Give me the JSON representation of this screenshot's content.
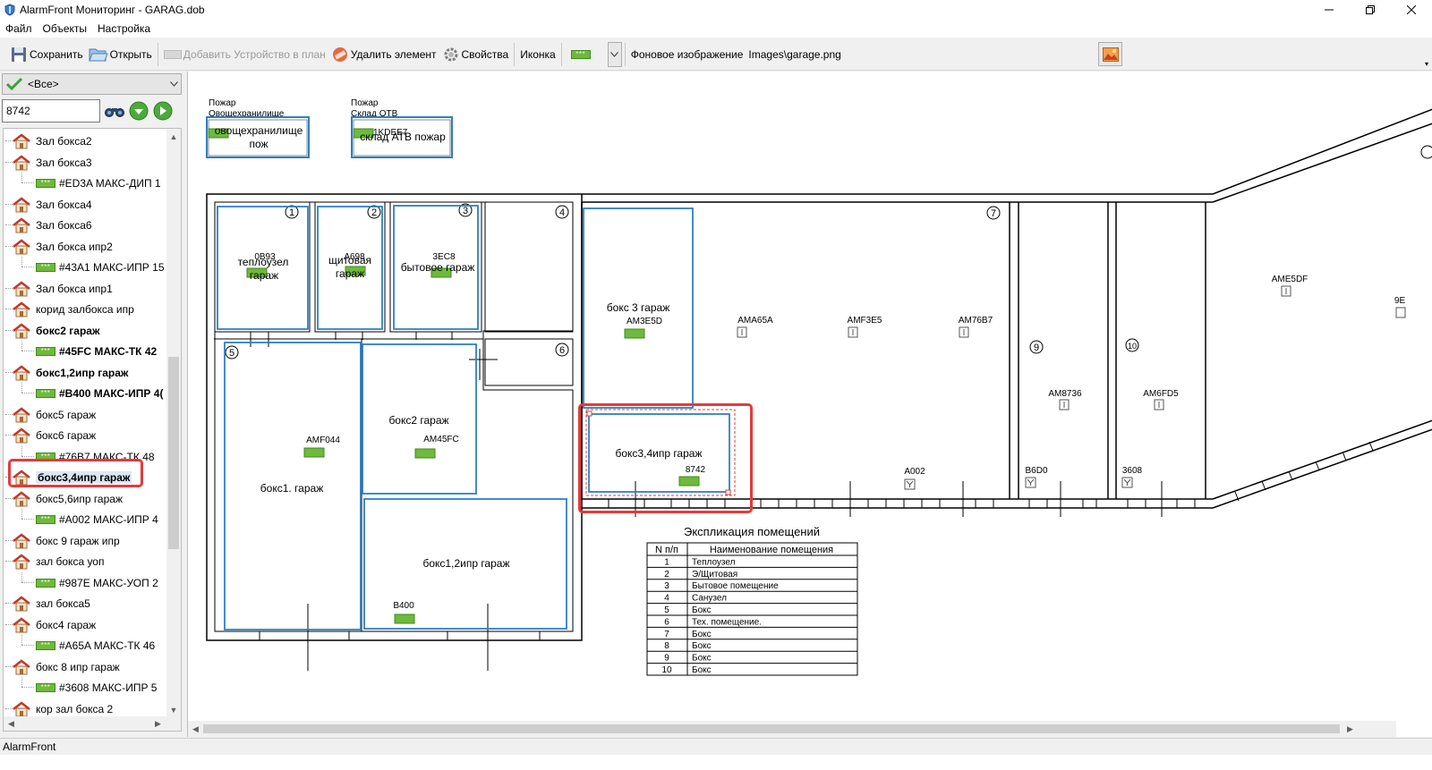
{
  "window": {
    "title": "AlarmFront Мониторинг - GARAG.dob"
  },
  "menu": [
    "Файл",
    "Объекты",
    "Настройка"
  ],
  "toolbar": {
    "save": "Сохранить",
    "open": "Открыть",
    "add_device": "Добавить Устройство в план",
    "delete": "Удалить элемент",
    "properties": "Свойства",
    "icon": "Иконка",
    "icon_glyph": "***",
    "bg_label": "Фоновое изображение",
    "bg_value": "Images\\garage.png"
  },
  "filter": {
    "value": "<Все>"
  },
  "search": {
    "value": "8742"
  },
  "tree": [
    {
      "type": "zone",
      "label": "Зал бокса2",
      "bold": false
    },
    {
      "type": "zone",
      "label": "Зал бокса3",
      "bold": false
    },
    {
      "type": "device",
      "label": "#ED3A МАКС-ДИП  1",
      "bold": false
    },
    {
      "type": "zone",
      "label": "Зал бокса4",
      "bold": false
    },
    {
      "type": "zone",
      "label": "Зал бокса6",
      "bold": false
    },
    {
      "type": "zone",
      "label": "Зал бокса ипр2",
      "bold": false
    },
    {
      "type": "device",
      "label": "#43A1 МАКС-ИПР  15",
      "bold": false
    },
    {
      "type": "zone",
      "label": "Зал бокса ипр1",
      "bold": false
    },
    {
      "type": "zone",
      "label": "корид залбокса ипр",
      "bold": false
    },
    {
      "type": "zone",
      "label": "бокс2 гараж",
      "bold": true
    },
    {
      "type": "device",
      "label": "#45FC МАКС-ТК  42",
      "bold": true
    },
    {
      "type": "zone",
      "label": "бокс1,2ипр гараж",
      "bold": true
    },
    {
      "type": "device",
      "label": "#B400 МАКС-ИПР  4(",
      "bold": true
    },
    {
      "type": "zone",
      "label": "бокс5 гараж",
      "bold": false
    },
    {
      "type": "zone",
      "label": "бокс6 гараж",
      "bold": false
    },
    {
      "type": "device",
      "label": "#76B7 МАКС-ТК  48",
      "bold": false
    },
    {
      "type": "zone",
      "label": "бокс3,4ипр гараж",
      "bold": true,
      "selected": true
    },
    {
      "type": "zone",
      "label": "бокс5,6ипр гараж",
      "bold": false
    },
    {
      "type": "device",
      "label": "#A002 МАКС-ИПР  4",
      "bold": false
    },
    {
      "type": "zone",
      "label": "бокс 9 гараж ипр",
      "bold": false
    },
    {
      "type": "zone",
      "label": "зал бокса уоп",
      "bold": false
    },
    {
      "type": "device",
      "label": "#987E МАКС-УОП  2",
      "bold": false
    },
    {
      "type": "zone",
      "label": "зал бокса5",
      "bold": false
    },
    {
      "type": "zone",
      "label": "бокс4 гараж",
      "bold": false
    },
    {
      "type": "device",
      "label": "#A65A МАКС-ТК  46",
      "bold": false
    },
    {
      "type": "zone",
      "label": "бокс 8 ипр гараж",
      "bold": false
    },
    {
      "type": "device",
      "label": "#3608 МАКС-ИПР  5",
      "bold": false
    },
    {
      "type": "zone",
      "label": "кор зал бокса 2",
      "bold": false
    }
  ],
  "plan": {
    "top_zones": [
      {
        "small_title": "Пожар",
        "small_sub": "Овощехранилище",
        "name_line1": "овощехранилище",
        "name_line2": "пож"
      },
      {
        "small_title": "Пожар",
        "small_sub": "Склад ОТВ",
        "name_line1": "склад АТВ пожар",
        "code": "1KDEE7"
      }
    ],
    "room_numbers": [
      "1",
      "2",
      "3",
      "4",
      "5",
      "6",
      "7",
      "9",
      "10"
    ],
    "zones": [
      {
        "line1": "теплоузел",
        "line2": "гараж",
        "code": "0B93"
      },
      {
        "line1": "щитовая",
        "line2": "гараж",
        "code": "A698"
      },
      {
        "line1": "бытовое гараж",
        "code": "3EC8"
      },
      {
        "line1": "бокс 3 гараж",
        "code": "AM3E5D"
      },
      {
        "line1": "бокс2 гараж",
        "code": "AM45FC"
      },
      {
        "line1": "бокс1. гараж",
        "code": "AMF044"
      },
      {
        "line1": "бокс1,2ипр гараж",
        "code": "B400"
      },
      {
        "line1": "бокс3,4ипр гараж",
        "code": "8742"
      }
    ],
    "sensors": [
      "AMA65A",
      "AMF3E5",
      "AM76B7",
      "AME5DF",
      "9E",
      "AM8736",
      "AM6FD5",
      "A002",
      "B6D0",
      "3608"
    ],
    "legend": {
      "title": "Экспликация помещений",
      "col1": "N п/п",
      "col2": "Наименование помещения",
      "rows": [
        [
          "1",
          "Теплоузел"
        ],
        [
          "2",
          "Э/Щитовая"
        ],
        [
          "3",
          "Бытовое помещение"
        ],
        [
          "4",
          "Санузел"
        ],
        [
          "5",
          "Бокс"
        ],
        [
          "6",
          "Тех. помещение."
        ],
        [
          "7",
          "Бокс"
        ],
        [
          "8",
          "Бокс"
        ],
        [
          "9",
          "Бокс"
        ],
        [
          "10",
          "Бокс"
        ]
      ]
    }
  },
  "status": "AlarmFront",
  "colors": {
    "highlight": "#e23b3b",
    "zone_border": "#2f7fc1",
    "device_green": "#6fb93c"
  }
}
